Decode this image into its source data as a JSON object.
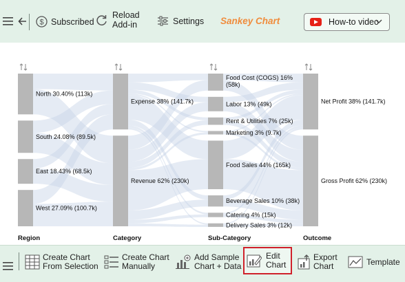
{
  "toolbar": {
    "subscribed_label": "Subscribed",
    "reload_line1": "Reload",
    "reload_line2": "Add-in",
    "settings_label": "Settings",
    "title": "Sankey Chart",
    "howto_label": "How-to video"
  },
  "chart_data": {
    "type": "sankey",
    "columns": [
      "Region",
      "Category",
      "Sub-Category",
      "Outcome"
    ],
    "nodes": [
      {
        "name": "North",
        "column": 0,
        "percent": "30.40%",
        "value": 113,
        "label": "North 30.40% (113k)"
      },
      {
        "name": "South",
        "column": 0,
        "percent": "24.08%",
        "value": 89.5,
        "label": "South 24.08% (89.5k)"
      },
      {
        "name": "East",
        "column": 0,
        "percent": "18.43%",
        "value": 68.5,
        "label": "East 18.43% (68.5k)"
      },
      {
        "name": "West",
        "column": 0,
        "percent": "27.09%",
        "value": 100.7,
        "label": "West 27.09% (100.7k)"
      },
      {
        "name": "Expense",
        "column": 1,
        "percent": "38%",
        "value": 141.7,
        "label": "Expense 38% (141.7k)"
      },
      {
        "name": "Revenue",
        "column": 1,
        "percent": "62%",
        "value": 230,
        "label": "Revenue 62% (230k)"
      },
      {
        "name": "Food Cost (COGS)",
        "column": 2,
        "percent": "16%",
        "value": 58,
        "label": "Food Cost (COGS) 16%",
        "label2": "(58k)"
      },
      {
        "name": "Labor",
        "column": 2,
        "percent": "13%",
        "value": 49,
        "label": "Labor 13% (49k)"
      },
      {
        "name": "Rent & Utilities",
        "column": 2,
        "percent": "7%",
        "value": 25,
        "label": "Rent & Utilities 7% (25k)"
      },
      {
        "name": "Marketing",
        "column": 2,
        "percent": "3%",
        "value": 9.7,
        "label": "Marketing 3% (9.7k)"
      },
      {
        "name": "Food Sales",
        "column": 2,
        "percent": "44%",
        "value": 165,
        "label": "Food Sales 44% (165k)"
      },
      {
        "name": "Beverage Sales",
        "column": 2,
        "percent": "10%",
        "value": 38,
        "label": "Beverage Sales 10% (38k)"
      },
      {
        "name": "Catering",
        "column": 2,
        "percent": "4%",
        "value": 15,
        "label": "Catering 4% (15k)"
      },
      {
        "name": "Delivery Sales",
        "column": 2,
        "percent": "3%",
        "value": 12,
        "label": "Delivery Sales 3% (12k)"
      },
      {
        "name": "Net Profit",
        "column": 3,
        "percent": "38%",
        "value": 141.7,
        "label": "Net Profit 38% (141.7k)"
      },
      {
        "name": "Gross Profit",
        "column": 3,
        "percent": "62%",
        "value": 230,
        "label": "Gross Profit 62% (230k)"
      }
    ],
    "node_color": "#b7b7b7",
    "link_color": "#c5d3e6"
  },
  "bottom": {
    "create_selection_l1": "Create Chart",
    "create_selection_l2": "From Selection",
    "create_manual_l1": "Create Chart",
    "create_manual_l2": "Manually",
    "add_sample_l1": "Add Sample",
    "add_sample_l2": "Chart + Data",
    "edit_l1": "Edit",
    "edit_l2": "Chart",
    "export_l1": "Export",
    "export_l2": "Chart",
    "template_label": "Template"
  }
}
